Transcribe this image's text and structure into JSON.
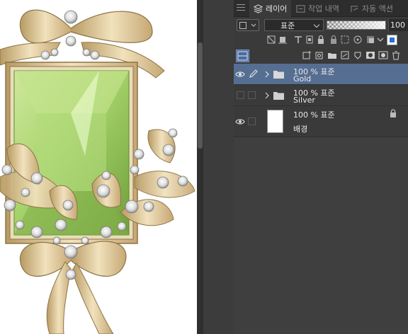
{
  "colors": {
    "panel_bg": "#3a3a3a",
    "selection": "#566e92",
    "gem_green": "#a7d36b",
    "gold": "#d9c28e"
  },
  "tabs": [
    {
      "label": "레이어",
      "icon": "layers-icon",
      "active": true
    },
    {
      "label": "작업 내역",
      "icon": "history-icon",
      "active": false
    },
    {
      "label": "자동 액션",
      "icon": "auto-action-icon",
      "active": false
    }
  ],
  "blend": {
    "mode": "표준",
    "opacity_fraction": 1.0,
    "opacity_text": "100"
  },
  "layers": [
    {
      "line1": "100 % 표준",
      "line2": "Gold",
      "type": "folder",
      "visible": true,
      "selected": true,
      "editing": true,
      "locked": false
    },
    {
      "line1": "100 % 표준",
      "line2": "Silver",
      "type": "folder",
      "visible": false,
      "selected": false,
      "editing": false,
      "locked": false
    },
    {
      "line1": "100 % 표준",
      "line2": "배경",
      "type": "raster",
      "visible": true,
      "selected": false,
      "editing": false,
      "locked": true
    }
  ]
}
